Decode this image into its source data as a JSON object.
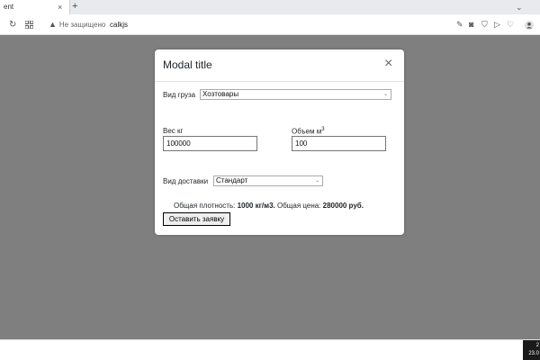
{
  "browser": {
    "tab_title": "ent",
    "tab_close": "×",
    "new_tab": "+",
    "tab_search": "⌄",
    "security_label": "Не защищено",
    "url": "calkjs"
  },
  "modal": {
    "title": "Modal title",
    "close_glyph": "×",
    "cargo_type_label": "Вид груза",
    "cargo_type_value": "Хозтовары",
    "weight_label": "Вес кг",
    "weight_value": "100000",
    "volume_label": "Объем м",
    "volume_unit_sup": "3",
    "volume_value": "100",
    "delivery_type_label": "Вид доставки",
    "delivery_type_value": "Стандарт",
    "result_density_label": "Общая плотность:",
    "result_density_value": "1000 кг/м3.",
    "result_price_label": "Общая цена:",
    "result_price_value": "280000 руб.",
    "submit_label": "Оставить заявку"
  },
  "taskbar": {
    "clock_line1": "2",
    "clock_line2": "23.0"
  }
}
